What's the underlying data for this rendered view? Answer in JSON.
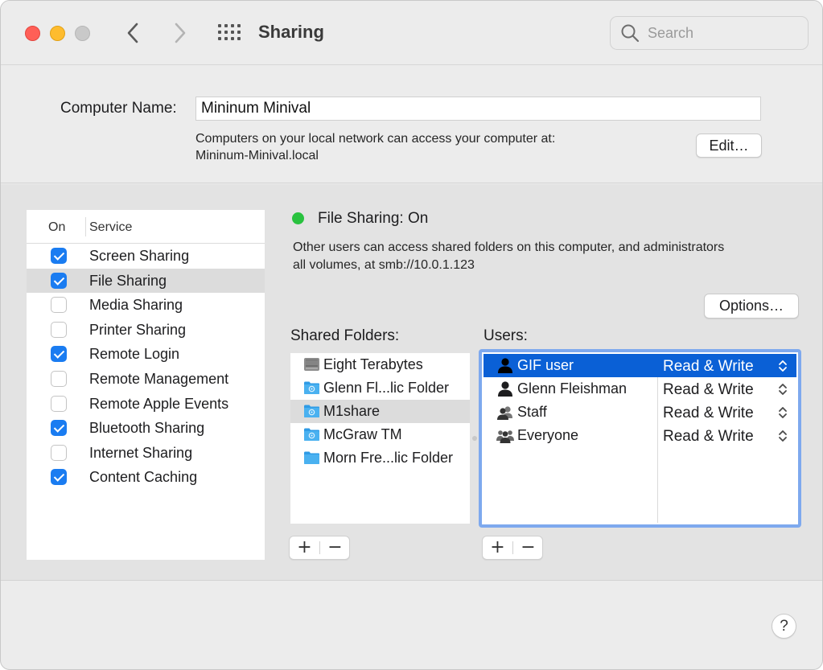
{
  "window": {
    "title": "Sharing",
    "search": {
      "placeholder": "Search",
      "value": ""
    },
    "nav": {
      "back": "‹",
      "forward": "›"
    }
  },
  "computer_name": {
    "label": "Computer Name:",
    "value": "Mininum Minival",
    "description_line1": "Computers on your local network can access your computer at:",
    "description_line2": "Mininum-Minival.local",
    "edit_label": "Edit…"
  },
  "services": {
    "header_on": "On",
    "header_service": "Service",
    "items": [
      {
        "name": "Screen Sharing",
        "checked": true,
        "selected": false
      },
      {
        "name": "File Sharing",
        "checked": true,
        "selected": true
      },
      {
        "name": "Media Sharing",
        "checked": false,
        "selected": false
      },
      {
        "name": "Printer Sharing",
        "checked": false,
        "selected": false
      },
      {
        "name": "Remote Login",
        "checked": true,
        "selected": false
      },
      {
        "name": "Remote Management",
        "checked": false,
        "selected": false
      },
      {
        "name": "Remote Apple Events",
        "checked": false,
        "selected": false
      },
      {
        "name": "Bluetooth Sharing",
        "checked": true,
        "selected": false
      },
      {
        "name": "Internet Sharing",
        "checked": false,
        "selected": false
      },
      {
        "name": "Content Caching",
        "checked": true,
        "selected": false
      }
    ]
  },
  "status": {
    "title": "File Sharing: On",
    "indicator_color": "#29c23f",
    "description_line1": "Other users can access shared folders on this computer, and administrators",
    "description_line2": "all volumes, at smb://10.0.1.123",
    "options_label": "Options…"
  },
  "shared_folders": {
    "label": "Shared Folders:",
    "items": [
      {
        "name": "Eight Terabytes",
        "icon": "drive-icon",
        "selected": false
      },
      {
        "name": "Glenn Fl...lic Folder",
        "icon": "public-folder-icon",
        "selected": false
      },
      {
        "name": "M1share",
        "icon": "public-folder-icon",
        "selected": true
      },
      {
        "name": "McGraw TM",
        "icon": "public-folder-icon",
        "selected": false
      },
      {
        "name": "Morn Fre...lic Folder",
        "icon": "folder-icon",
        "selected": false
      }
    ],
    "add": "+",
    "remove": "−"
  },
  "users": {
    "label": "Users:",
    "items": [
      {
        "name": "GIF user",
        "permission": "Read & Write",
        "icon": "user-icon",
        "selected": true
      },
      {
        "name": "Glenn Fleishman",
        "permission": "Read & Write",
        "icon": "user-icon",
        "selected": false
      },
      {
        "name": "Staff",
        "permission": "Read & Write",
        "icon": "group-icon",
        "selected": false
      },
      {
        "name": "Everyone",
        "permission": "Read & Write",
        "icon": "everyone-icon",
        "selected": false
      }
    ],
    "add": "+",
    "remove": "−",
    "selection_color": "#0a60d6"
  },
  "help": {
    "label": "?"
  },
  "colors": {
    "accent": "#1a7cf1",
    "focus_ring": "#7ea9ee"
  }
}
